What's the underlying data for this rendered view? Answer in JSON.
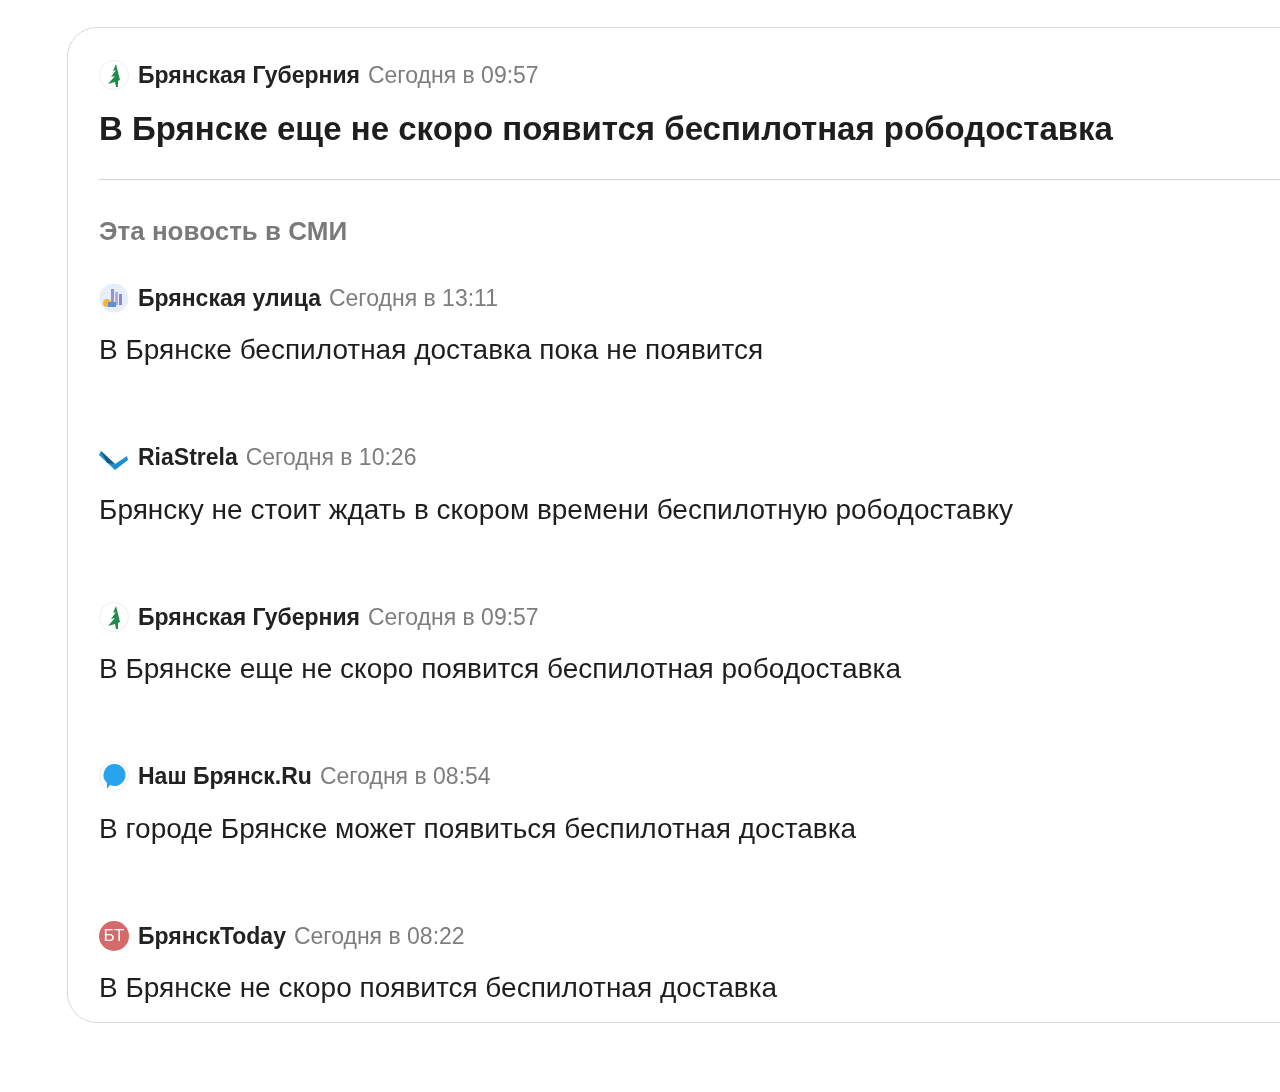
{
  "story": {
    "source": {
      "name": "Брянская Губерния",
      "time": "Сегодня в 09:57",
      "logo": {
        "kind": "tree"
      }
    },
    "title": "В Брянске еще не скоро появится беспилотная рободоставка"
  },
  "coverage": {
    "heading": "Эта новость в СМИ",
    "items": [
      {
        "source": "Брянская улица",
        "time": "Сегодня в 13:11",
        "logo": {
          "kind": "city"
        },
        "headline": "В Брянске беспилотная доставка пока не появится"
      },
      {
        "source": "RiaStrela",
        "time": "Сегодня в 10:26",
        "logo": {
          "kind": "arrow"
        },
        "headline": "Брянску не стоит ждать в скором времени беспилотную рободоставку"
      },
      {
        "source": "Брянская Губерния",
        "time": "Сегодня в 09:57",
        "logo": {
          "kind": "tree"
        },
        "headline": "В Брянске еще не скоро появится беспилотная рободоставка"
      },
      {
        "source": "Наш Брянск.Ru",
        "time": "Сегодня в 08:54",
        "logo": {
          "kind": "bubble"
        },
        "headline": "В городе Брянске может появиться беспилотная доставка"
      },
      {
        "source": "БрянскToday",
        "time": "Сегодня в 08:22",
        "logo": {
          "kind": "initials",
          "text": "БТ"
        },
        "headline": "В Брянске не скоро появится беспилотная доставка"
      }
    ]
  }
}
